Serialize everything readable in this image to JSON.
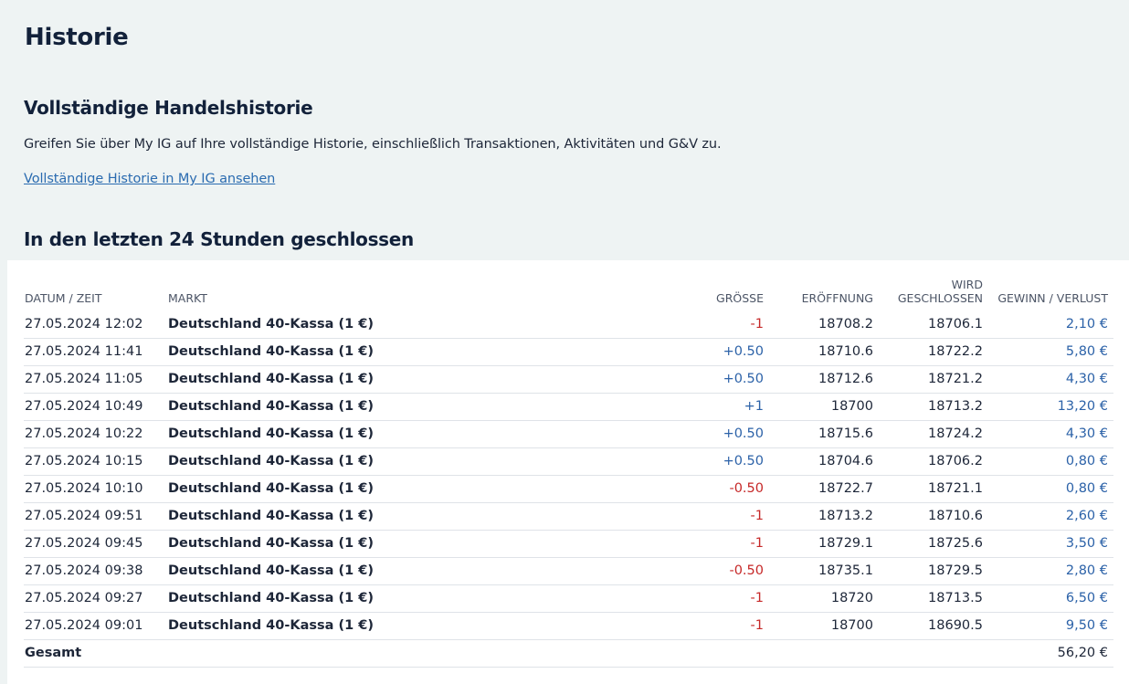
{
  "header": {
    "title": "Historie"
  },
  "full_history": {
    "title": "Vollständige Handelshistorie",
    "description": "Greifen Sie über My IG auf Ihre vollständige Historie, einschließlich Transaktionen, Aktivitäten und G&V zu.",
    "link_label": "Vollständige Historie in My IG ansehen"
  },
  "closed": {
    "title": "In den letzten 24 Stunden geschlossen",
    "columns": {
      "date": "DATUM / ZEIT",
      "market": "MARKT",
      "size": "GRÖSSE",
      "open": "ERÖFFNUNG",
      "close_line1": "WIRD",
      "close_line2": "GESCHLOSSEN",
      "pl": "GEWINN / VERLUST"
    },
    "rows": [
      {
        "date": "27.05.2024 12:02",
        "market": "Deutschland 40-Kassa (1 €)",
        "size": "-1",
        "open": "18708.2",
        "close": "18706.1",
        "pl": "2,10 €"
      },
      {
        "date": "27.05.2024 11:41",
        "market": "Deutschland 40-Kassa (1 €)",
        "size": "+0.50",
        "open": "18710.6",
        "close": "18722.2",
        "pl": "5,80 €"
      },
      {
        "date": "27.05.2024 11:05",
        "market": "Deutschland 40-Kassa (1 €)",
        "size": "+0.50",
        "open": "18712.6",
        "close": "18721.2",
        "pl": "4,30 €"
      },
      {
        "date": "27.05.2024 10:49",
        "market": "Deutschland 40-Kassa (1 €)",
        "size": "+1",
        "open": "18700",
        "close": "18713.2",
        "pl": "13,20 €"
      },
      {
        "date": "27.05.2024 10:22",
        "market": "Deutschland 40-Kassa (1 €)",
        "size": "+0.50",
        "open": "18715.6",
        "close": "18724.2",
        "pl": "4,30 €"
      },
      {
        "date": "27.05.2024 10:15",
        "market": "Deutschland 40-Kassa (1 €)",
        "size": "+0.50",
        "open": "18704.6",
        "close": "18706.2",
        "pl": "0,80 €"
      },
      {
        "date": "27.05.2024 10:10",
        "market": "Deutschland 40-Kassa (1 €)",
        "size": "-0.50",
        "open": "18722.7",
        "close": "18721.1",
        "pl": "0,80 €"
      },
      {
        "date": "27.05.2024 09:51",
        "market": "Deutschland 40-Kassa (1 €)",
        "size": "-1",
        "open": "18713.2",
        "close": "18710.6",
        "pl": "2,60 €"
      },
      {
        "date": "27.05.2024 09:45",
        "market": "Deutschland 40-Kassa (1 €)",
        "size": "-1",
        "open": "18729.1",
        "close": "18725.6",
        "pl": "3,50 €"
      },
      {
        "date": "27.05.2024 09:38",
        "market": "Deutschland 40-Kassa (1 €)",
        "size": "-0.50",
        "open": "18735.1",
        "close": "18729.5",
        "pl": "2,80 €"
      },
      {
        "date": "27.05.2024 09:27",
        "market": "Deutschland 40-Kassa (1 €)",
        "size": "-1",
        "open": "18720",
        "close": "18713.5",
        "pl": "6,50 €"
      },
      {
        "date": "27.05.2024 09:01",
        "market": "Deutschland 40-Kassa (1 €)",
        "size": "-1",
        "open": "18700",
        "close": "18690.5",
        "pl": "9,50 €"
      }
    ],
    "total": {
      "label": "Gesamt",
      "pl": "56,20 €"
    }
  },
  "colors": {
    "background": "#eef3f3",
    "panel": "#ffffff",
    "positive": "#2c62a8",
    "negative": "#c62828",
    "link": "#2a6bb0"
  }
}
